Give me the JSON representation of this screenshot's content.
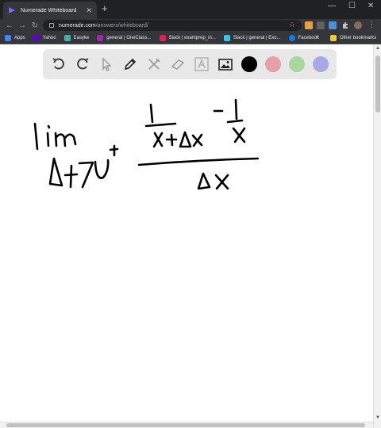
{
  "browser": {
    "tab_title": "Numerade Whiteboard",
    "new_tab_glyph": "+",
    "url_host": "numerade.com",
    "url_path": "/answers/whiteboard/"
  },
  "bookmarks": {
    "items": [
      "Apps",
      "Yahoo",
      "Easyke",
      "general | OneClass...",
      "Slack | examprep_in...",
      "Slack | general | Exo...",
      "Facebook"
    ],
    "more": "»",
    "other": "Other bookmarks"
  },
  "whiteboard": {
    "tools": [
      "undo-icon",
      "redo-icon",
      "select-pointer-icon",
      "pen-icon",
      "tools-icon",
      "eraser-icon",
      "text-icon",
      "image-icon"
    ],
    "colors": {
      "black": "#000000",
      "red": "#e8a0a8",
      "green": "#a8d8a0",
      "purple": "#a8a8e8"
    }
  }
}
